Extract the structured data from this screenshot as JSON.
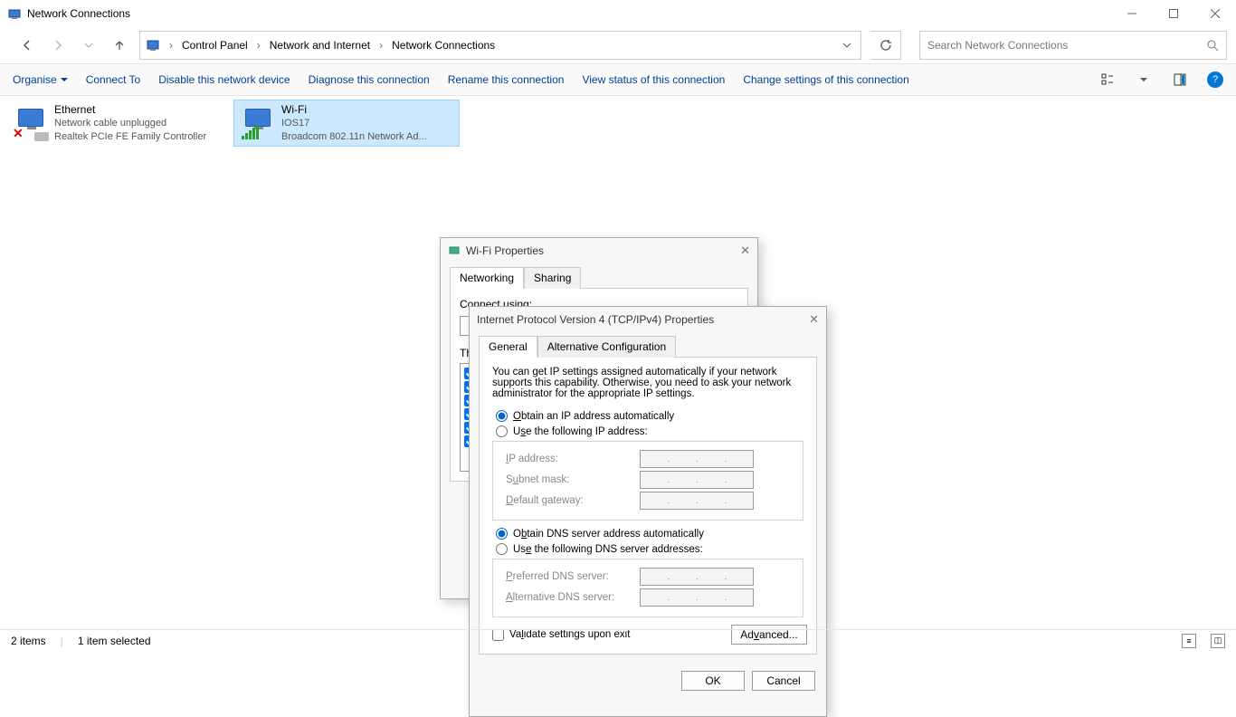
{
  "window": {
    "title": "Network Connections"
  },
  "breadcrumb": {
    "root": "Control Panel",
    "mid": "Network and Internet",
    "leaf": "Network Connections"
  },
  "search": {
    "placeholder": "Search Network Connections"
  },
  "toolbar": {
    "organise": "Organise",
    "connect_to": "Connect To",
    "disable": "Disable this network device",
    "diagnose": "Diagnose this connection",
    "rename": "Rename this connection",
    "view_status": "View status of this connection",
    "change_settings": "Change settings of this connection"
  },
  "connections": [
    {
      "name": "Ethernet",
      "status": "Network cable unplugged",
      "device": "Realtek PCIe FE Family Controller",
      "selected": false,
      "kind": "wired-unplugged"
    },
    {
      "name": "Wi-Fi",
      "status": "IOS17",
      "device": "Broadcom 802.11n Network Ad...",
      "selected": true,
      "kind": "wifi"
    }
  ],
  "statusbar": {
    "count": "2 items",
    "selected": "1 item selected"
  },
  "wifi_dialog": {
    "title": "Wi-Fi Properties",
    "tabs": {
      "networking": "Networking",
      "sharing": "Sharing"
    },
    "connect_using_label": "Connect using:"
  },
  "ipv4_dialog": {
    "title": "Internet Protocol Version 4 (TCP/IPv4) Properties",
    "tabs": {
      "general": "General",
      "alt": "Alternative Configuration"
    },
    "description": "You can get IP settings assigned automatically if your network supports this capability. Otherwise, you need to ask your network administrator for the appropriate IP settings.",
    "ip_auto": "Obtain an IP address automatically",
    "ip_manual": "Use the following IP address:",
    "ip_address": "IP address:",
    "subnet": "Subnet mask:",
    "gateway": "Default gateway:",
    "dns_auto": "Obtain DNS server address automatically",
    "dns_manual": "Use the following DNS server addresses:",
    "pref_dns": "Preferred DNS server:",
    "alt_dns": "Alternative DNS server:",
    "validate": "Validate settings upon exit",
    "advanced": "Advanced...",
    "ok": "OK",
    "cancel": "Cancel"
  }
}
